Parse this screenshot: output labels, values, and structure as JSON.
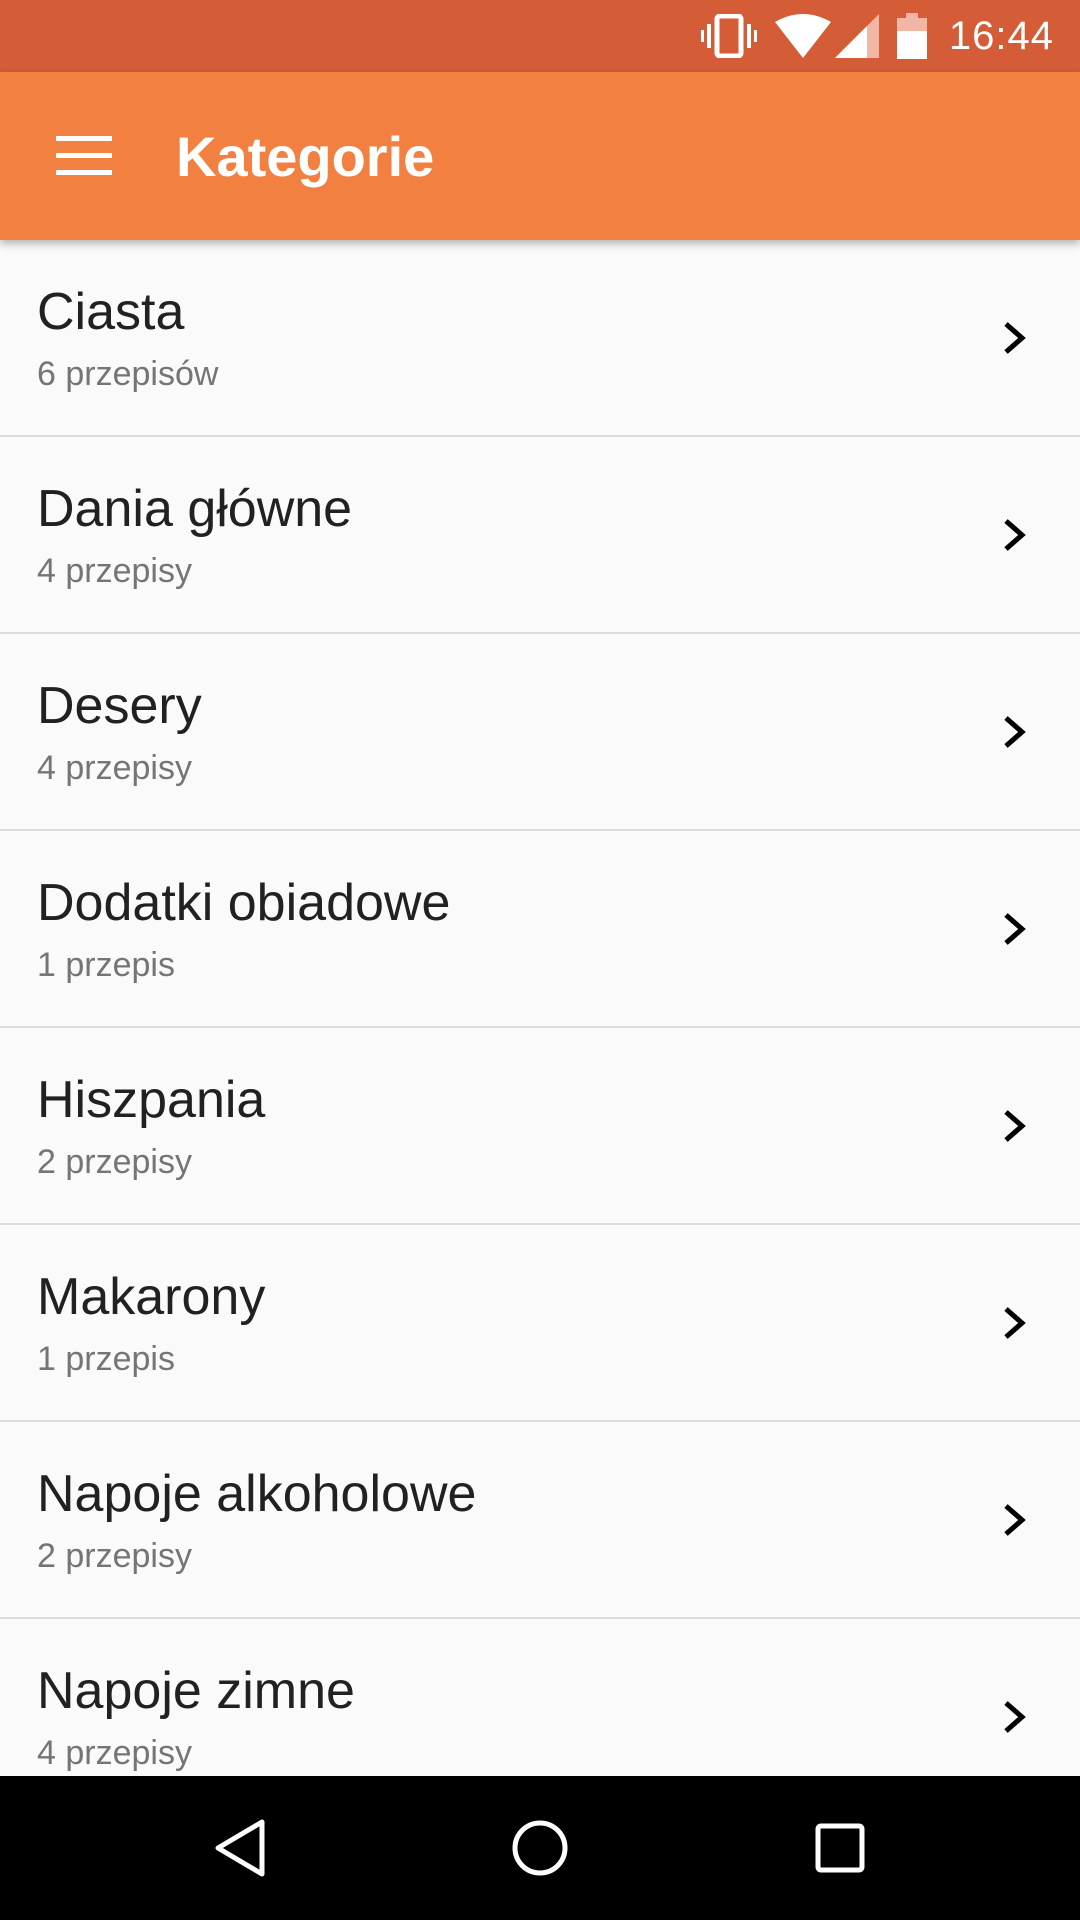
{
  "status_bar": {
    "time": "16:44",
    "icons": [
      "vibrate-icon",
      "wifi-icon",
      "cell-signal-icon",
      "battery-icon"
    ],
    "color": "#d45c36"
  },
  "app_bar": {
    "title": "Kategorie",
    "menu_icon": "hamburger-menu-icon",
    "color": "#f28040"
  },
  "categories": [
    {
      "name": "Ciasta",
      "count": "6 przepisów"
    },
    {
      "name": "Dania główne",
      "count": "4 przepisy"
    },
    {
      "name": "Desery",
      "count": "4 przepisy"
    },
    {
      "name": "Dodatki obiadowe",
      "count": "1 przepis"
    },
    {
      "name": "Hiszpania",
      "count": "2 przepisy"
    },
    {
      "name": "Makarony",
      "count": "1 przepis"
    },
    {
      "name": "Napoje alkoholowe",
      "count": "2 przepisy"
    },
    {
      "name": "Napoje zimne",
      "count": "4 przepisy"
    }
  ],
  "nav_bar": {
    "buttons": [
      "back-icon",
      "home-icon",
      "recents-icon"
    ]
  }
}
